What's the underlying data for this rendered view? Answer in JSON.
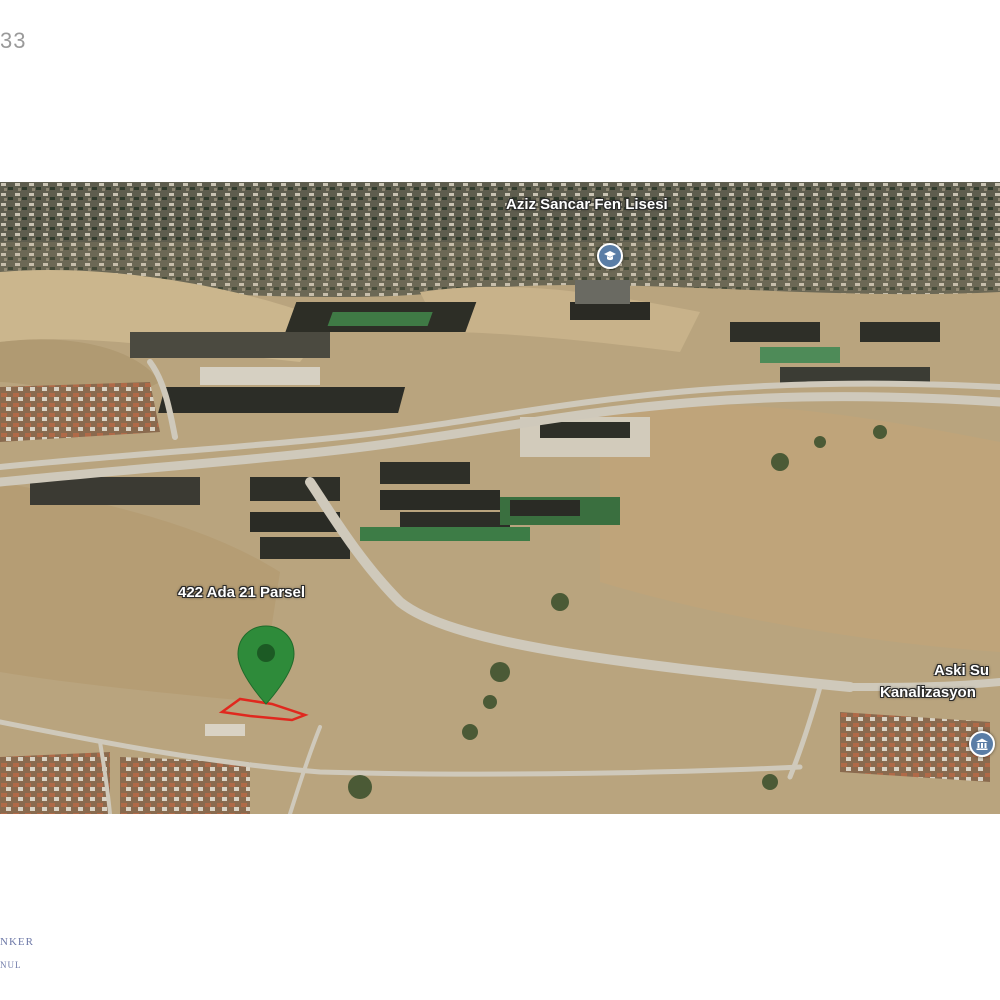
{
  "header": {
    "corner_number": "33"
  },
  "map": {
    "labels": {
      "school": "Aziz Sancar Fen Lisesi",
      "parcel": "422 Ada 21 Parsel",
      "aski_line1": "Aski Su",
      "aski_line2": "Kanalizasyon"
    },
    "icons": {
      "school": "school-poi-icon",
      "aski": "government-building-poi-icon",
      "pin": "location-pin-icon"
    },
    "colors": {
      "pin": "#2e8b3a",
      "parcel_outline": "#e0281e",
      "poi": "#5a7da6"
    }
  },
  "footer": {
    "watermark_line1": "NKER",
    "watermark_line2": "NUL"
  }
}
